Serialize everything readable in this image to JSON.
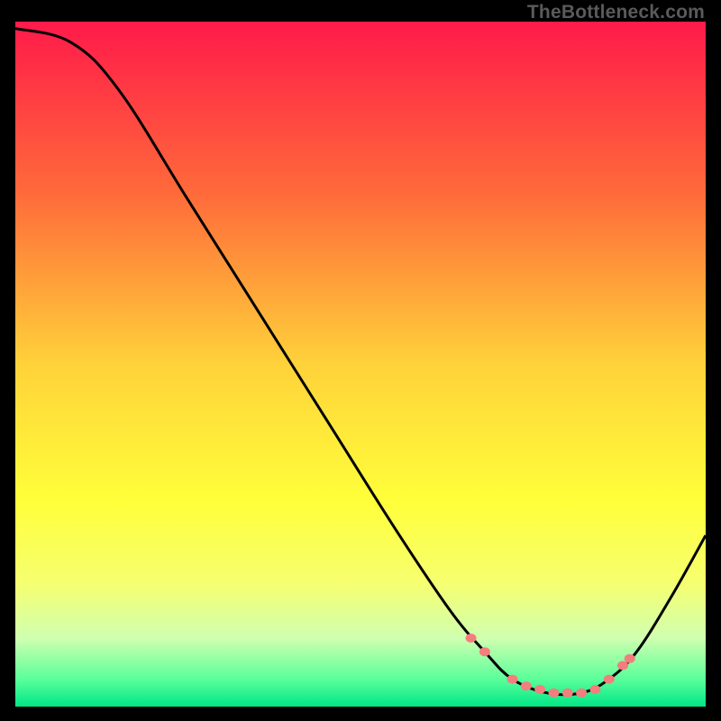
{
  "watermark": "TheBottleneck.com",
  "chart_data": {
    "type": "line",
    "title": "",
    "xlabel": "",
    "ylabel": "",
    "xlim": [
      0,
      100
    ],
    "ylim": [
      0,
      100
    ],
    "gradient_stops": [
      {
        "offset": 0,
        "color": "#ff1a4a"
      },
      {
        "offset": 0.25,
        "color": "#ff6a3a"
      },
      {
        "offset": 0.5,
        "color": "#ffd23a"
      },
      {
        "offset": 0.7,
        "color": "#ffff3a"
      },
      {
        "offset": 0.82,
        "color": "#f6ff70"
      },
      {
        "offset": 0.9,
        "color": "#d0ffb0"
      },
      {
        "offset": 0.96,
        "color": "#5aff9a"
      },
      {
        "offset": 1.0,
        "color": "#00e686"
      }
    ],
    "curve": [
      {
        "x": 0,
        "y": 99
      },
      {
        "x": 8,
        "y": 97
      },
      {
        "x": 15,
        "y": 90
      },
      {
        "x": 25,
        "y": 74
      },
      {
        "x": 35,
        "y": 58
      },
      {
        "x": 45,
        "y": 42
      },
      {
        "x": 55,
        "y": 26
      },
      {
        "x": 63,
        "y": 14
      },
      {
        "x": 68,
        "y": 8
      },
      {
        "x": 72,
        "y": 4
      },
      {
        "x": 77,
        "y": 2
      },
      {
        "x": 82,
        "y": 2
      },
      {
        "x": 86,
        "y": 4
      },
      {
        "x": 90,
        "y": 8
      },
      {
        "x": 95,
        "y": 16
      },
      {
        "x": 100,
        "y": 25
      }
    ],
    "markers": [
      {
        "x": 66,
        "y": 10
      },
      {
        "x": 68,
        "y": 8
      },
      {
        "x": 72,
        "y": 4
      },
      {
        "x": 74,
        "y": 3
      },
      {
        "x": 76,
        "y": 2.5
      },
      {
        "x": 78,
        "y": 2
      },
      {
        "x": 80,
        "y": 2
      },
      {
        "x": 82,
        "y": 2
      },
      {
        "x": 84,
        "y": 2.5
      },
      {
        "x": 86,
        "y": 4
      },
      {
        "x": 88,
        "y": 6
      },
      {
        "x": 89,
        "y": 7
      }
    ],
    "marker_color": "#f47d7d",
    "curve_color": "#000000"
  }
}
